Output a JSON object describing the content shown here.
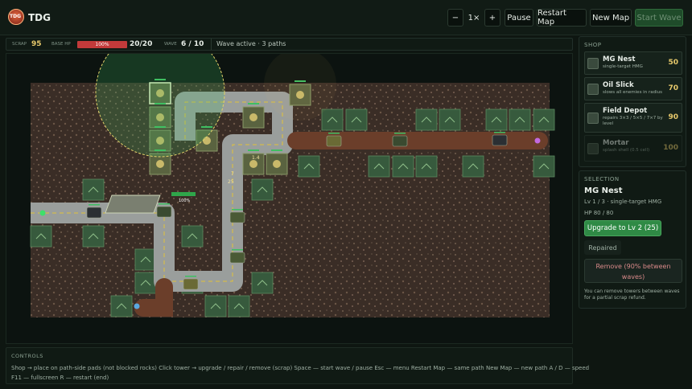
{
  "app": {
    "logo_text": "TDG",
    "title": "TDG"
  },
  "toolbar": {
    "speed_minus": "−",
    "speed_value": "1×",
    "speed_plus": "+",
    "pause": "Pause",
    "restart_map": "Restart Map",
    "new_map": "New Map",
    "start_wave": "Start Wave"
  },
  "hud": {
    "scrap_label": "SCRAP",
    "scrap_value": "95",
    "base_hp_label": "BASE HP",
    "base_hp_percent": "100%",
    "base_hp_fraction": 1.0,
    "base_hp_value": "20/20",
    "wave_label": "WAVE",
    "wave_value": "6 / 10",
    "status": "Wave active · 3 paths"
  },
  "map": {
    "base_label": "100%",
    "damage_labels": [
      "1.4",
      "7",
      "25"
    ],
    "colors": {
      "path": "#9a9e9c",
      "dirt_path": "#6b3e2a",
      "pad": "#375a3d",
      "rock": "#3a2d26",
      "range": "#3fbf62"
    }
  },
  "controls": {
    "title": "CONTROLS",
    "line1": "Shop → place on path-side pads (not blocked rocks)     Click tower → upgrade / repair / remove (scrap)     Space — start wave / pause     Esc — menu     Restart Map — same path     New Map — new path     A / D — speed",
    "line2": "F11 — fullscreen     R — restart (end)"
  },
  "shop": {
    "title": "SHOP",
    "items": [
      {
        "name": "MG Nest",
        "desc": "single-target HMG",
        "price": "50",
        "icon": "mg-nest-icon"
      },
      {
        "name": "Oil Slick",
        "desc": "slows all enemies in radius",
        "price": "70",
        "icon": "oil-slick-icon"
      },
      {
        "name": "Field Depot",
        "desc": "repairs 3×3 / 5×5 / 7×7 by level",
        "price": "90",
        "icon": "field-depot-icon"
      },
      {
        "name": "Mortar",
        "desc": "splash shell (0.5 cell)",
        "price": "100",
        "icon": "mortar-icon"
      }
    ]
  },
  "selection": {
    "title": "SELECTION",
    "name": "MG Nest",
    "level_info": "Lv 1 / 3 · single-target HMG",
    "hp": "HP 80 / 80",
    "upgrade": "Upgrade to Lv 2 (25)",
    "repaired": "Repaired",
    "remove": "Remove (90% between waves)",
    "note": "You can remove towers between waves for a partial scrap refund."
  }
}
